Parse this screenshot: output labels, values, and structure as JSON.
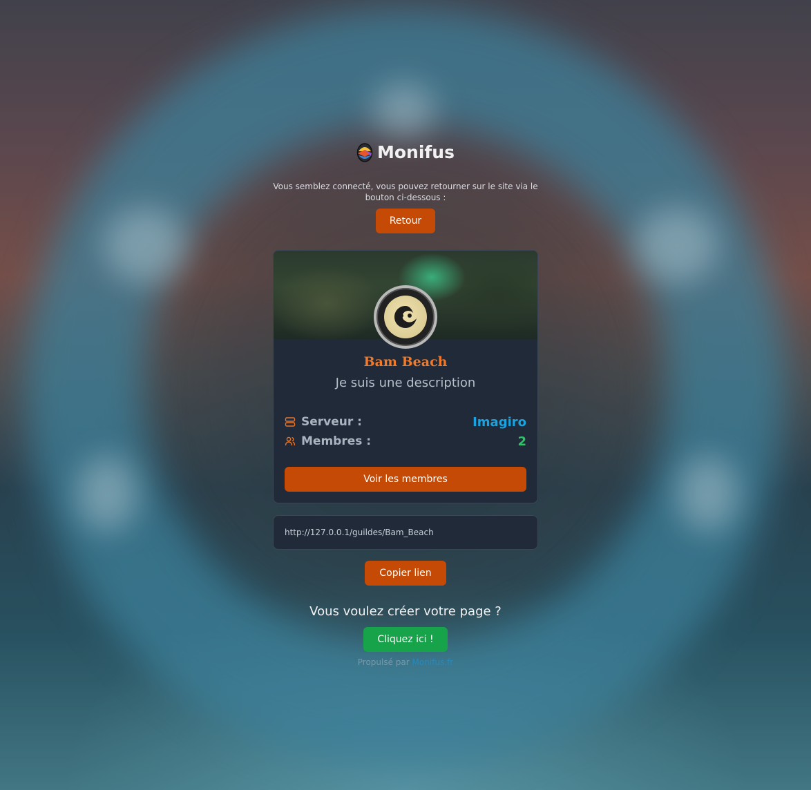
{
  "brand": {
    "name": "Monifus"
  },
  "intro": {
    "text": "Vous semblez connecté, vous pouvez retourner sur le site via le bouton ci-dessous :"
  },
  "back_button": {
    "label": "Retour"
  },
  "guild": {
    "name": "Bam Beach",
    "description": "Je suis une description",
    "server_label": "Serveur :",
    "server_value": "Imagiro",
    "members_label": "Membres :",
    "members_value": "2",
    "members_button": "Voir les membres"
  },
  "share": {
    "url": "http://127.0.0.1/guildes/Bam_Beach",
    "copy_button": "Copier lien"
  },
  "cta": {
    "question": "Vous voulez créer votre page ?",
    "button": "Cliquez ici !"
  },
  "footer": {
    "prefix": "Propulsé par",
    "link": "Monifus.fr"
  },
  "colors": {
    "accent": "#c44a06",
    "guild_name": "#f07a2a",
    "server": "#1aa3e0",
    "members": "#2fc46b",
    "cta": "#16a34a"
  },
  "icons": {
    "server": "server-icon",
    "members": "users-icon",
    "logo": "egg-icon"
  }
}
